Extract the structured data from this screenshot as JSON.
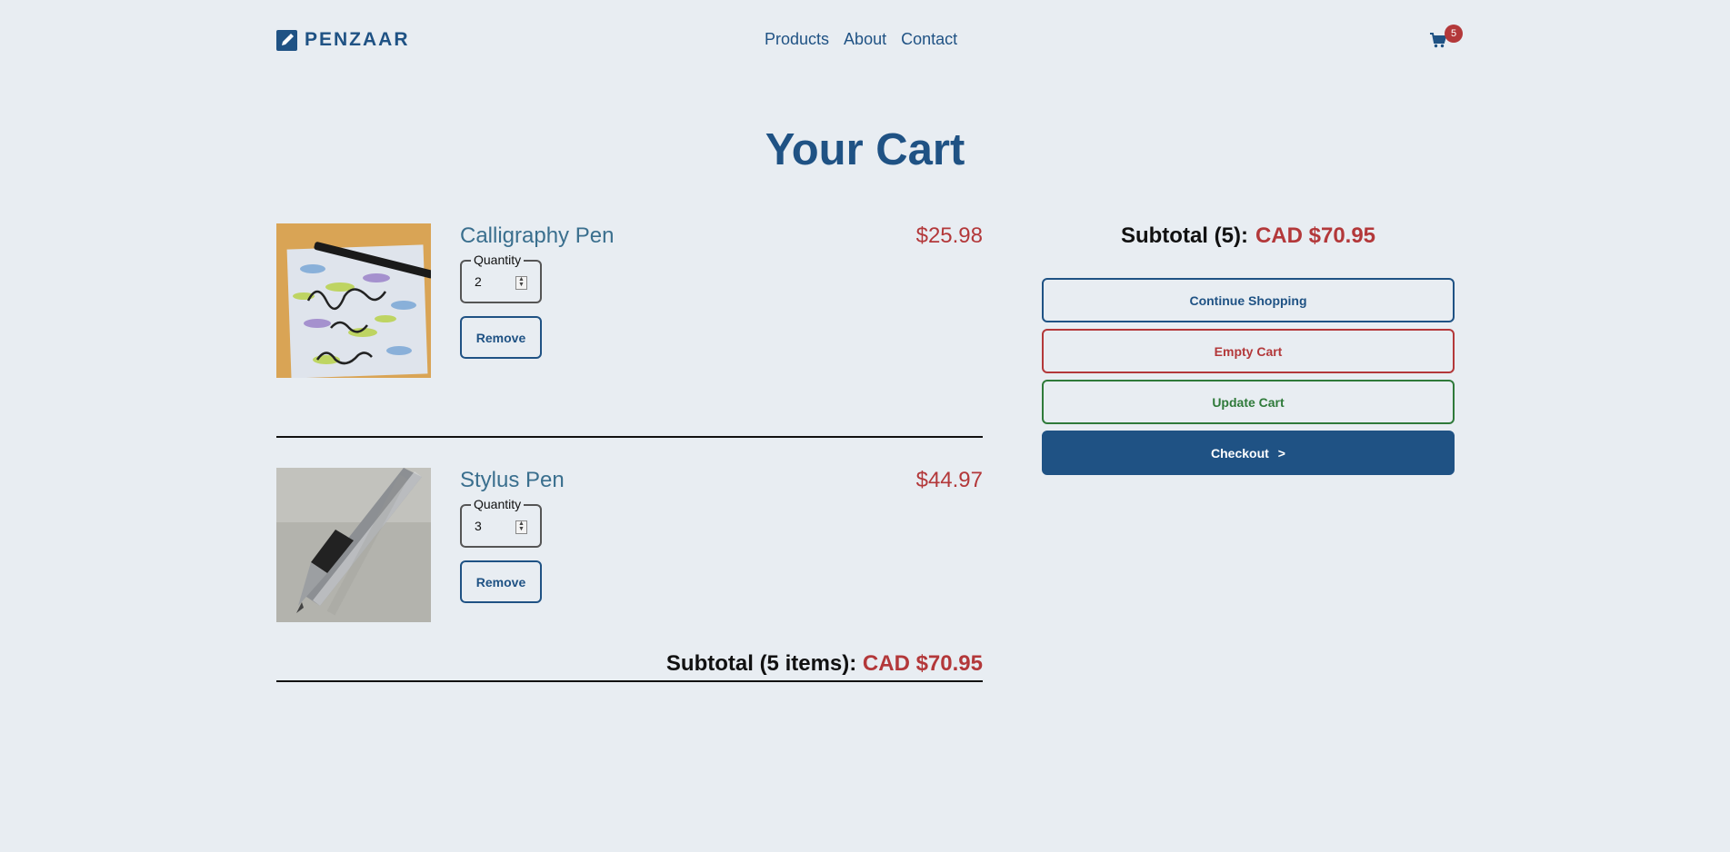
{
  "brand": {
    "name": "PENZAAR",
    "icon": "pen-icon"
  },
  "nav": {
    "items": [
      "Products",
      "About",
      "Contact"
    ]
  },
  "cart": {
    "icon": "cart-icon",
    "count": "5"
  },
  "page_title": "Your Cart",
  "items": [
    {
      "name": "Calligraphy Pen",
      "price": "$25.98",
      "quantity_label": "Quantity",
      "quantity": "2",
      "remove_label": "Remove"
    },
    {
      "name": "Stylus Pen",
      "price": "$44.97",
      "quantity_label": "Quantity",
      "quantity": "3",
      "remove_label": "Remove"
    }
  ],
  "list_subtotal": {
    "label": "Subtotal (5 items):",
    "amount": "CAD $70.95"
  },
  "summary": {
    "subtotal_label": "Subtotal (5):",
    "subtotal_amount": "CAD $70.95",
    "continue_label": "Continue Shopping",
    "empty_label": "Empty Cart",
    "update_label": "Update Cart",
    "checkout_label": "Checkout",
    "checkout_chevron": ">"
  },
  "colors": {
    "primary": "#1f5284",
    "danger": "#b3383a",
    "success": "#2f7a3a",
    "background": "#e8edf2"
  }
}
